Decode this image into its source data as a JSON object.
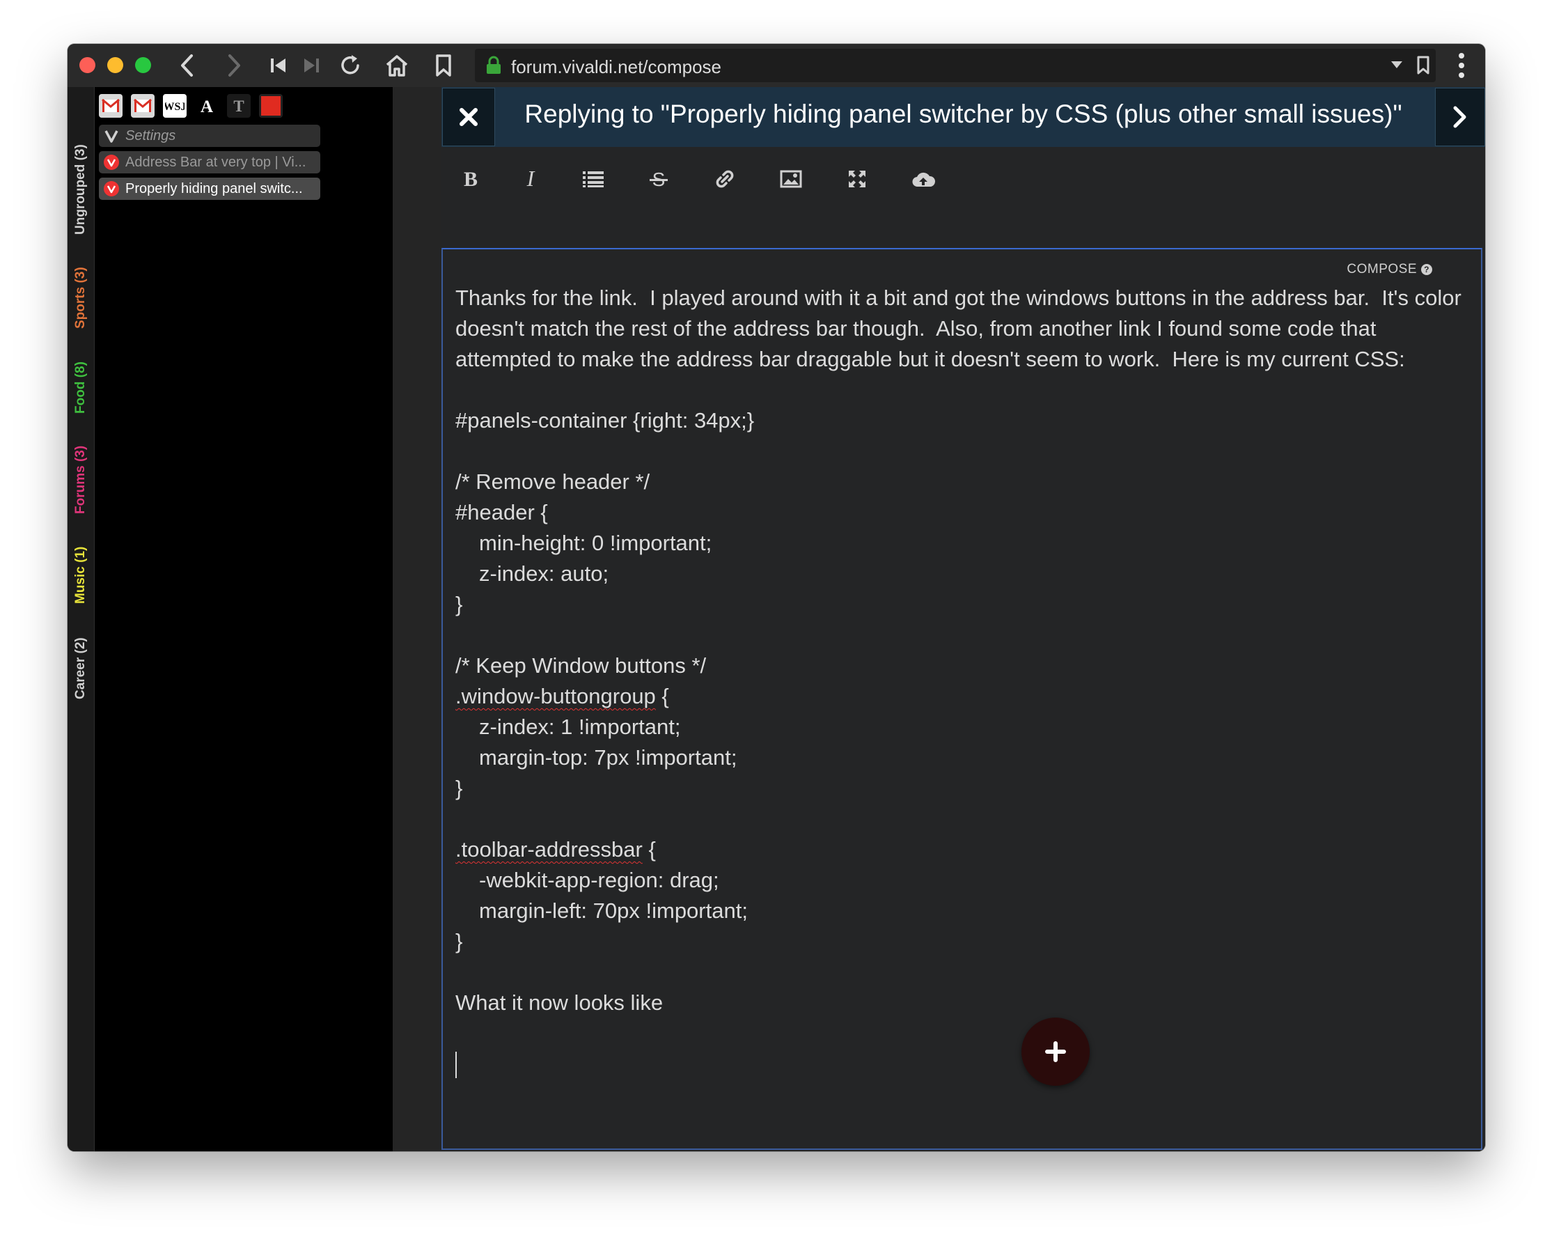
{
  "browser": {
    "url": "forum.vivaldi.net/compose",
    "nav_icons": [
      "back-icon",
      "forward-icon",
      "rewind-icon",
      "fast-forward-icon",
      "reload-icon",
      "home-icon",
      "bookmark-icon"
    ]
  },
  "panel_groups": [
    {
      "label": "Ungrouped (3)",
      "color": "#d0d0d0"
    },
    {
      "label": "Sports (3)",
      "color": "#e0733a"
    },
    {
      "label": "Food (8)",
      "color": "#3fbf3f"
    },
    {
      "label": "Forums (3)",
      "color": "#e0357a"
    },
    {
      "label": "Music (1)",
      "color": "#e6e23a"
    },
    {
      "label": "Career (2)",
      "color": "#d0d0d0"
    }
  ],
  "favicons": [
    "gmail-icon",
    "gmail-icon",
    "wsj-icon",
    "a-icon",
    "nyt-icon",
    "red-square-icon"
  ],
  "tabs": [
    {
      "label": "Settings",
      "italic": true
    },
    {
      "label": "Address Bar at very top | Vi..."
    },
    {
      "label": "Properly hiding panel switc..."
    }
  ],
  "composer": {
    "title": "Replying to \"Properly hiding panel switcher by CSS (plus other small issues)\"",
    "mode_label": "COMPOSE",
    "toolbar": [
      "bold-icon",
      "italic-icon",
      "list-icon",
      "strikethrough-icon",
      "link-icon",
      "image-icon",
      "fullscreen-icon",
      "upload-icon"
    ],
    "body": {
      "p1": "Thanks for the link.  I played around with it a bit and got the windows buttons in the address bar.  It's color doesn't match the rest of the address bar though.  Also, from another link I found some code that attempted to make the address bar draggable but it doesn't seem to work.  Here is my current CSS:",
      "l1": "#panels-container {right: 34px;}",
      "l2": "/* Remove header */",
      "l3": "#header {",
      "l4": "min-height: 0 !important;",
      "l5": "z-index: auto;",
      "l6": "}",
      "l7": "/* Keep Window buttons */",
      "l8a": ".window-buttongroup",
      "l8b": " {",
      "l9": "z-index: 1 !important;",
      "l10": "margin-top: 7px !important;",
      "l11": "}",
      "l12a": ".toolbar-addressbar",
      "l12b": " {",
      "l13": "-webkit-app-region: drag;",
      "l14": "margin-left: 70px !important;",
      "l15": "}",
      "l16": "What it now looks like"
    }
  }
}
